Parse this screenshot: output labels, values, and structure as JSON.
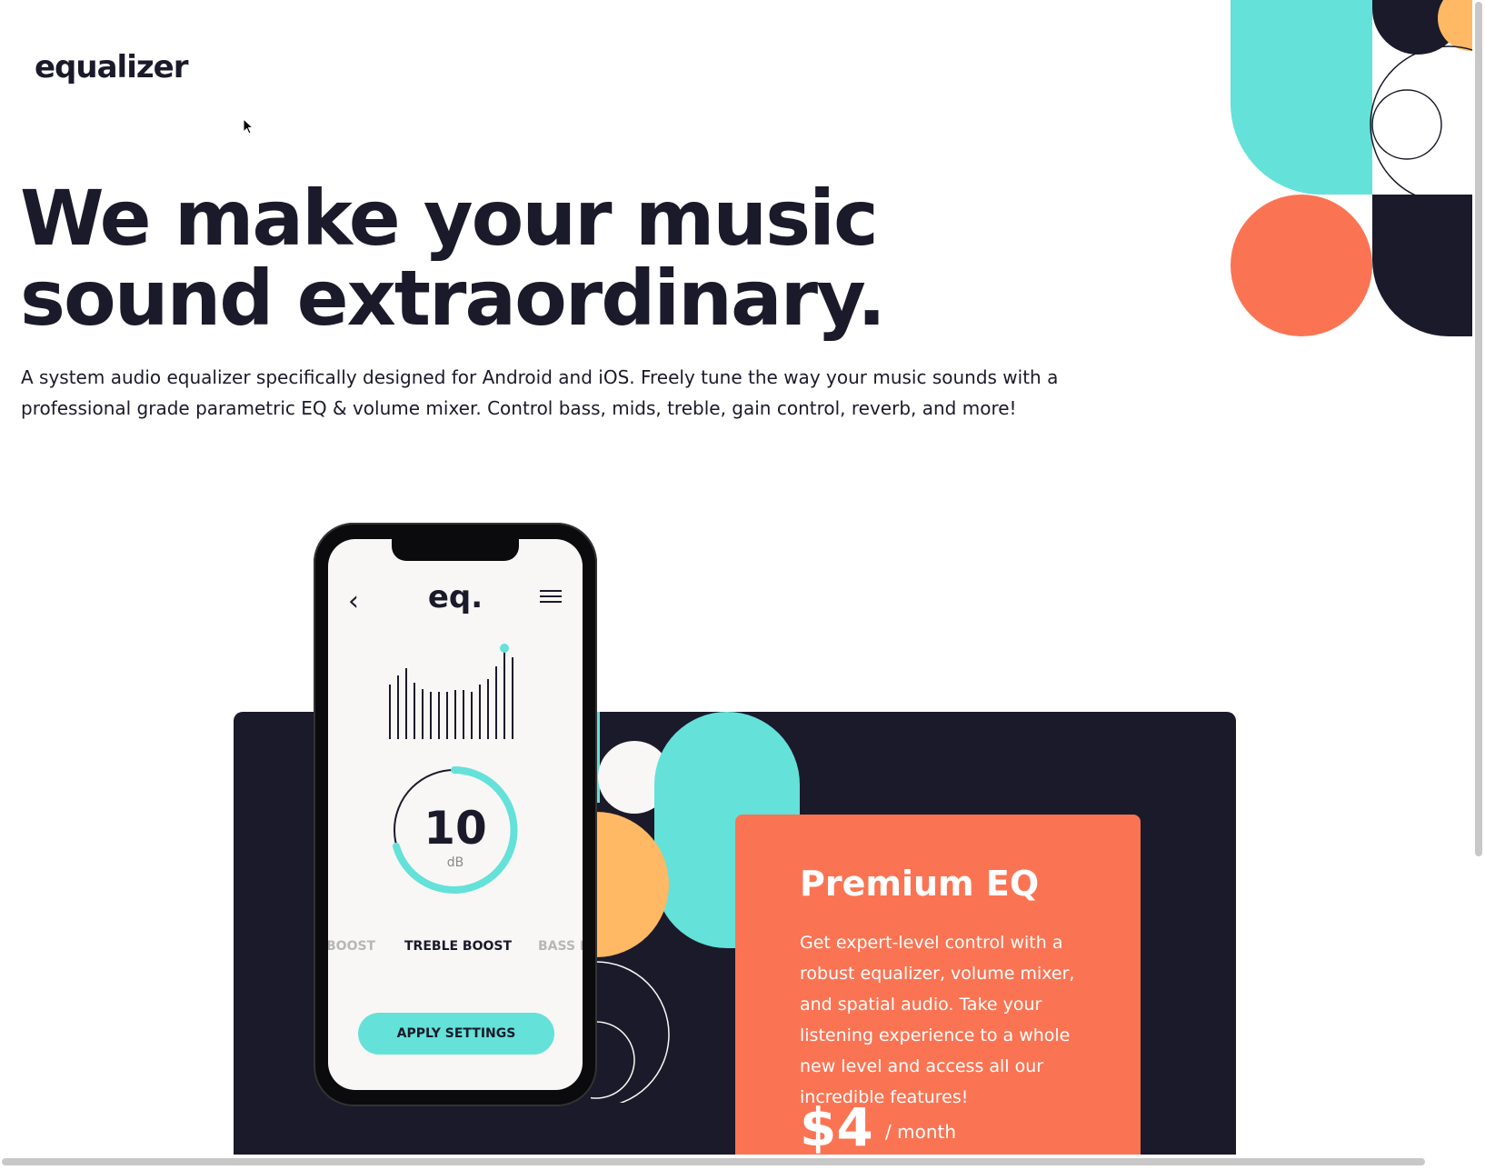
{
  "header": {
    "logo": "equalizer"
  },
  "hero": {
    "headline": "We make your music sound extraordinary.",
    "description": "A system audio equalizer specifically designed for Android and iOS. Freely tune the way your music sounds with a professional grade parametric EQ & volume mixer. Control bass, mids, treble, gain control, reverb, and more!"
  },
  "phone_app": {
    "title": "eq.",
    "dial_value": "10",
    "dial_unit": "dB",
    "modes": {
      "previous": "BOOST",
      "current": "TREBLE BOOST",
      "next": "BASS B"
    },
    "apply_label": "APPLY SETTINGS"
  },
  "premium": {
    "title": "Premium EQ",
    "description": "Get expert-level control with a robust equalizer, volume mixer, and spatial audio. Take your listening experience to a whole new level and access all our incredible features!",
    "price": "$4",
    "period": "/ month"
  },
  "colors": {
    "dark": "#1b1a2a",
    "turquoise": "#64e1d9",
    "coral": "#fa7453",
    "yellow": "#ffb964",
    "offwhite": "#f8f7f5"
  },
  "icons": [
    "back-chevron-icon",
    "hamburger-menu-icon",
    "mouse-cursor-icon"
  ]
}
